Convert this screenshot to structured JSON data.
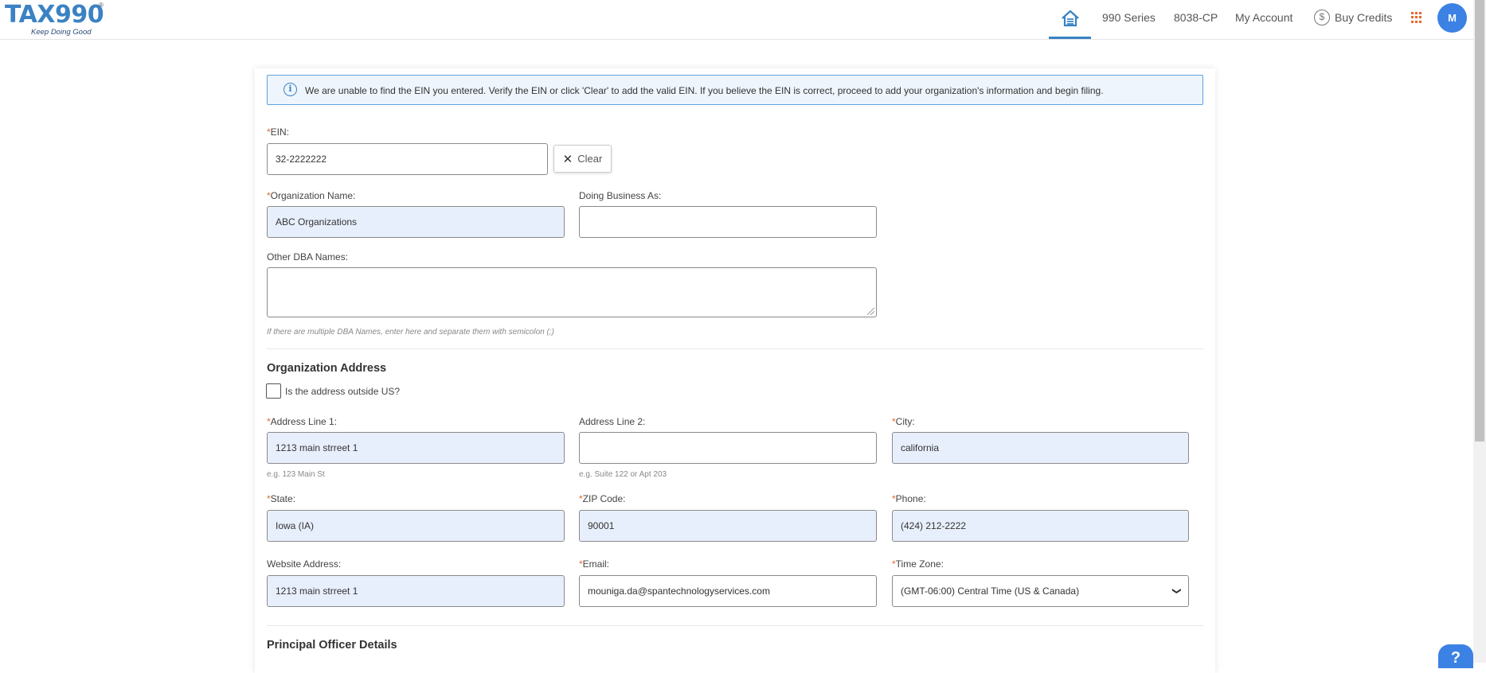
{
  "header": {
    "logo": "TAX990",
    "logo_registered": "®",
    "tagline": "Keep Doing Good",
    "nav": [
      "990 Series",
      "8038-CP",
      "My Account",
      "Buy Credits"
    ],
    "avatar_initial": "M",
    "accent_color": "#3b82c4"
  },
  "alert": {
    "message": "We are unable to find the EIN you entered. Verify the EIN or click 'Clear' to add the valid EIN. If you believe the EIN is correct, proceed to add your organization's information and begin filing."
  },
  "form": {
    "ein_label": "EIN:",
    "ein_value": "32-2222222",
    "clear_label": "Clear",
    "org_name_label": "Organization Name:",
    "org_name_value": "ABC Organizations",
    "dba_label": "Doing Business As:",
    "dba_value": "",
    "other_dba_label": "Other DBA Names:",
    "other_dba_hint": "If there are multiple DBA Names, enter here and separate them with semicolon (;)",
    "address_section": "Organization Address",
    "outside_us_label": "Is the address outside US?",
    "address1_label": "Address Line 1:",
    "address1_value": "1213 main strreet 1",
    "address1_hint": "e.g. 123 Main St",
    "address2_label": "Address Line 2:",
    "address2_value": "",
    "address2_hint": "e.g. Suite 122 or Apt 203",
    "city_label": "City:",
    "city_value": "california",
    "state_label": "State:",
    "state_value": "Iowa (IA)",
    "zip_label": "ZIP Code:",
    "zip_value": "90001",
    "phone_label": "Phone:",
    "phone_value": "(424) 212-2222",
    "website_label": "Website Address:",
    "website_value": "1213 main strreet 1",
    "email_label": "Email:",
    "email_value": "mouniga.da@spantechnologyservices.com",
    "timezone_label": "Time Zone:",
    "timezone_value": "(GMT-06:00) Central Time (US & Canada)",
    "officer_section": "Principal Officer Details",
    "required_mark": "*"
  },
  "help_label": "?"
}
